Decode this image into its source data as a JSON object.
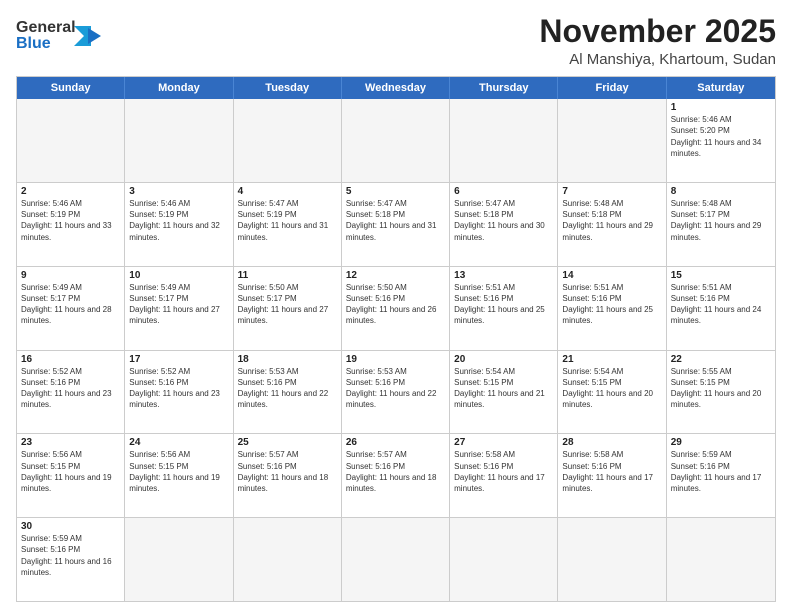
{
  "header": {
    "logo_general": "General",
    "logo_blue": "Blue",
    "month": "November 2025",
    "location": "Al Manshiya, Khartoum, Sudan"
  },
  "days_of_week": [
    "Sunday",
    "Monday",
    "Tuesday",
    "Wednesday",
    "Thursday",
    "Friday",
    "Saturday"
  ],
  "weeks": [
    [
      {
        "num": "",
        "empty": true
      },
      {
        "num": "",
        "empty": true
      },
      {
        "num": "",
        "empty": true
      },
      {
        "num": "",
        "empty": true
      },
      {
        "num": "",
        "empty": true
      },
      {
        "num": "",
        "empty": true
      },
      {
        "num": "1",
        "sunrise": "5:46 AM",
        "sunset": "5:20 PM",
        "daylight": "11 hours and 34 minutes."
      }
    ],
    [
      {
        "num": "2",
        "sunrise": "5:46 AM",
        "sunset": "5:19 PM",
        "daylight": "11 hours and 33 minutes."
      },
      {
        "num": "3",
        "sunrise": "5:46 AM",
        "sunset": "5:19 PM",
        "daylight": "11 hours and 32 minutes."
      },
      {
        "num": "4",
        "sunrise": "5:47 AM",
        "sunset": "5:19 PM",
        "daylight": "11 hours and 31 minutes."
      },
      {
        "num": "5",
        "sunrise": "5:47 AM",
        "sunset": "5:18 PM",
        "daylight": "11 hours and 31 minutes."
      },
      {
        "num": "6",
        "sunrise": "5:47 AM",
        "sunset": "5:18 PM",
        "daylight": "11 hours and 30 minutes."
      },
      {
        "num": "7",
        "sunrise": "5:48 AM",
        "sunset": "5:18 PM",
        "daylight": "11 hours and 29 minutes."
      },
      {
        "num": "8",
        "sunrise": "5:48 AM",
        "sunset": "5:17 PM",
        "daylight": "11 hours and 29 minutes."
      }
    ],
    [
      {
        "num": "9",
        "sunrise": "5:49 AM",
        "sunset": "5:17 PM",
        "daylight": "11 hours and 28 minutes."
      },
      {
        "num": "10",
        "sunrise": "5:49 AM",
        "sunset": "5:17 PM",
        "daylight": "11 hours and 27 minutes."
      },
      {
        "num": "11",
        "sunrise": "5:50 AM",
        "sunset": "5:17 PM",
        "daylight": "11 hours and 27 minutes."
      },
      {
        "num": "12",
        "sunrise": "5:50 AM",
        "sunset": "5:16 PM",
        "daylight": "11 hours and 26 minutes."
      },
      {
        "num": "13",
        "sunrise": "5:51 AM",
        "sunset": "5:16 PM",
        "daylight": "11 hours and 25 minutes."
      },
      {
        "num": "14",
        "sunrise": "5:51 AM",
        "sunset": "5:16 PM",
        "daylight": "11 hours and 25 minutes."
      },
      {
        "num": "15",
        "sunrise": "5:51 AM",
        "sunset": "5:16 PM",
        "daylight": "11 hours and 24 minutes."
      }
    ],
    [
      {
        "num": "16",
        "sunrise": "5:52 AM",
        "sunset": "5:16 PM",
        "daylight": "11 hours and 23 minutes."
      },
      {
        "num": "17",
        "sunrise": "5:52 AM",
        "sunset": "5:16 PM",
        "daylight": "11 hours and 23 minutes."
      },
      {
        "num": "18",
        "sunrise": "5:53 AM",
        "sunset": "5:16 PM",
        "daylight": "11 hours and 22 minutes."
      },
      {
        "num": "19",
        "sunrise": "5:53 AM",
        "sunset": "5:16 PM",
        "daylight": "11 hours and 22 minutes."
      },
      {
        "num": "20",
        "sunrise": "5:54 AM",
        "sunset": "5:15 PM",
        "daylight": "11 hours and 21 minutes."
      },
      {
        "num": "21",
        "sunrise": "5:54 AM",
        "sunset": "5:15 PM",
        "daylight": "11 hours and 20 minutes."
      },
      {
        "num": "22",
        "sunrise": "5:55 AM",
        "sunset": "5:15 PM",
        "daylight": "11 hours and 20 minutes."
      }
    ],
    [
      {
        "num": "23",
        "sunrise": "5:56 AM",
        "sunset": "5:15 PM",
        "daylight": "11 hours and 19 minutes."
      },
      {
        "num": "24",
        "sunrise": "5:56 AM",
        "sunset": "5:15 PM",
        "daylight": "11 hours and 19 minutes."
      },
      {
        "num": "25",
        "sunrise": "5:57 AM",
        "sunset": "5:16 PM",
        "daylight": "11 hours and 18 minutes."
      },
      {
        "num": "26",
        "sunrise": "5:57 AM",
        "sunset": "5:16 PM",
        "daylight": "11 hours and 18 minutes."
      },
      {
        "num": "27",
        "sunrise": "5:58 AM",
        "sunset": "5:16 PM",
        "daylight": "11 hours and 17 minutes."
      },
      {
        "num": "28",
        "sunrise": "5:58 AM",
        "sunset": "5:16 PM",
        "daylight": "11 hours and 17 minutes."
      },
      {
        "num": "29",
        "sunrise": "5:59 AM",
        "sunset": "5:16 PM",
        "daylight": "11 hours and 17 minutes."
      }
    ],
    [
      {
        "num": "30",
        "sunrise": "5:59 AM",
        "sunset": "5:16 PM",
        "daylight": "11 hours and 16 minutes."
      },
      {
        "num": "",
        "empty": true
      },
      {
        "num": "",
        "empty": true
      },
      {
        "num": "",
        "empty": true
      },
      {
        "num": "",
        "empty": true
      },
      {
        "num": "",
        "empty": true
      },
      {
        "num": "",
        "empty": true
      }
    ]
  ],
  "labels": {
    "sunrise": "Sunrise:",
    "sunset": "Sunset:",
    "daylight": "Daylight:"
  }
}
